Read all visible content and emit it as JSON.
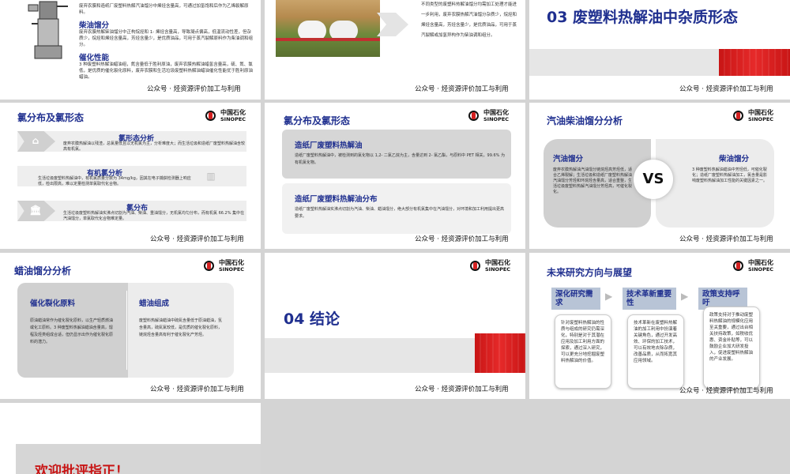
{
  "slide1": {
    "line1": "废弃农膜和造纸厂废塑料热解汽油馏分中烯烃含量高，可通过加氢饱和后作为乙烯裂解原料。",
    "heading_a": "柴油馏分",
    "text_a": "废弃农膜热解柴油馏分中正构烷烃和 1- 烯烃含量高，导致凝点偏高，低温流动性差，但杂质少，烷烃和烯烃含量高，芳烃含量少，是优质油品，可用于蒸汽裂解原料作为柴油调和组分。",
    "heading_b": "催化性能",
    "text_b": "3 种废塑料热解油蜡油组，氮含量低于胜利原油，废弃农膜热解油蜡氢含量高，硫、氮、氯低，是优质的催化裂化原料，废弃农膜和生活垃圾废塑料热解油蜡油催化性能优于胜利原油蜡油。",
    "footer": "公众号 · 烃资源评价加工与利用"
  },
  "slide2": {
    "text": "不同类型的废塑料热解油馏分均需加工处理才能进一步利用，废弃农膜热解汽油馏分杂质少，烷烃和烯烃含量高，芳烃含量少，是优质油品，可用于蒸汽裂解或加氢异构作为柴油调和组分。",
    "footer": "公众号 · 烃资源评价加工与利用"
  },
  "slide3": {
    "title": "03 废塑料热解油中杂质形态",
    "footer": "公众号 · 烃资源评价加工与利用"
  },
  "logo": {
    "cn": "中国石化",
    "en": "SINOPEC",
    "sub": "Sinopec"
  },
  "slide4": {
    "title": "氯分布及氯形态",
    "rows": [
      {
        "heading": "氯形态分析",
        "text": "废弃农膜热解油以残渣，总氯量低且以无机氯为主，分析难度大；而生活垃圾和造纸厂废塑料热解油含较高有机氯。",
        "icon": "home-icon"
      },
      {
        "heading": "有机氯分析",
        "text": "生活垃圾废塑料热解油中，有机氯质量分数为 34mg/kg，因其在电子捕获检测器上响应低，检出限高，难以定量检测单氯取代化合物。",
        "icon": "chart-icon"
      },
      {
        "heading": "氯分布",
        "text": "生活垃圾废塑料热解油实沸点切割为汽油、柴油、重油馏分，无机氯均匀分布，而有机氯 66.2% 集中在汽油馏分，单氯取代化合物难定量。",
        "icon": "bank-icon"
      }
    ],
    "footer": "公众号 · 烃资源评价加工与利用"
  },
  "slide5": {
    "title": "氯分布及氯形态",
    "card1_heading": "造纸厂废塑料热解油",
    "card1_text": "造纸厂废塑料热解油中，被检测到的氯化物以 1,2- 二氯乙烷为主，含量达到 2- 氯乙酯，与原料中 PET 相关，99.6% 为有机氯化物。",
    "card2_heading": "造纸厂废塑料热解油分布",
    "card2_text": "造纸厂废塑料热解油实沸点切割为汽油、柴油、蜡油馏分，绝大部分有机氯集中在汽油馏分，对环境和加工利用提出更高要求。",
    "footer": "公众号 · 烃资源评价加工与利用"
  },
  "slide6": {
    "title": "汽油柴油馏分分析",
    "left_heading": "汽油馏分",
    "left_text": "废弃农膜热解油汽油馏分链烷烃高芳烃低，适合乙烯裂解；生活垃圾和造纸厂废塑料热解油汽油馏分芳烃和环烷烃含量高，适合重整，生活垃圾废塑料热解汽油馏分芳烃高，可催化裂化。",
    "vs": "VS",
    "right_heading": "柴油馏分",
    "right_text": "3 种废塑料热解油蜡油中芳烃低，可催化裂化；造纸厂废塑料热解油加工，氯含量是影响废塑料热解油加工性能的关键因素之一。",
    "footer": "公众号 · 烃资源评价加工与利用"
  },
  "slide7": {
    "title": "蜡油馏分分析",
    "left_heading": "催化裂化原料",
    "left_text": "原油蜡油常作为催化裂化原料，以生产轻质燃油或化工原料。3 种废塑料热解油蜡油含量高，馏程及烃类组成合适，但仍显示出作为催化裂化原料的潜力。",
    "right_heading": "蜡油组成",
    "right_text": "废塑料热解油蜡油中硫氮含量低于原油蜡油，氢含量高，硫氮氯较低，是优质的催化裂化原料，链烷烃含量高有利于催化裂化产芳烃。",
    "footer": "公众号 · 烃资源评价加工与利用"
  },
  "slide8": {
    "title": "04 结论",
    "footer": "公众号 · 烃资源评价加工与利用"
  },
  "slide9": {
    "title": "未来研究方向与展望",
    "cols": [
      {
        "tag": "深化研究需求",
        "text": "针对废塑料热解油的性质与组成的研究仍需深化，特别是对于其潜在应用及加工利用方面的探索，通过深入研究，可以更充分地挖掘废塑料热解油的价值。"
      },
      {
        "tag": "技术革新重要性",
        "text": "技术革新在废塑料热解油的加工利用中扮演着关键角色，通过开发高效、环保的加工技术，可以有效地去除杂质，改善品质，从而拓宽其应用领域。"
      },
      {
        "tag": "政策支持呼吁",
        "text": "政策支持对于推动废塑料热解油的规模化应用至关重要，通过出台相关扶持政策，如税收优惠、资金补贴等，可以鼓励企业加大研发投入，促进废塑料热解油的产业发展。"
      }
    ],
    "footer": "公众号 · 烃资源评价加工与利用"
  },
  "slide10": {
    "title": "欢迎批评指正！"
  },
  "colors": {
    "blue": "#1f2f8f",
    "red": "#d42020",
    "gray": "#d4d4d4"
  }
}
